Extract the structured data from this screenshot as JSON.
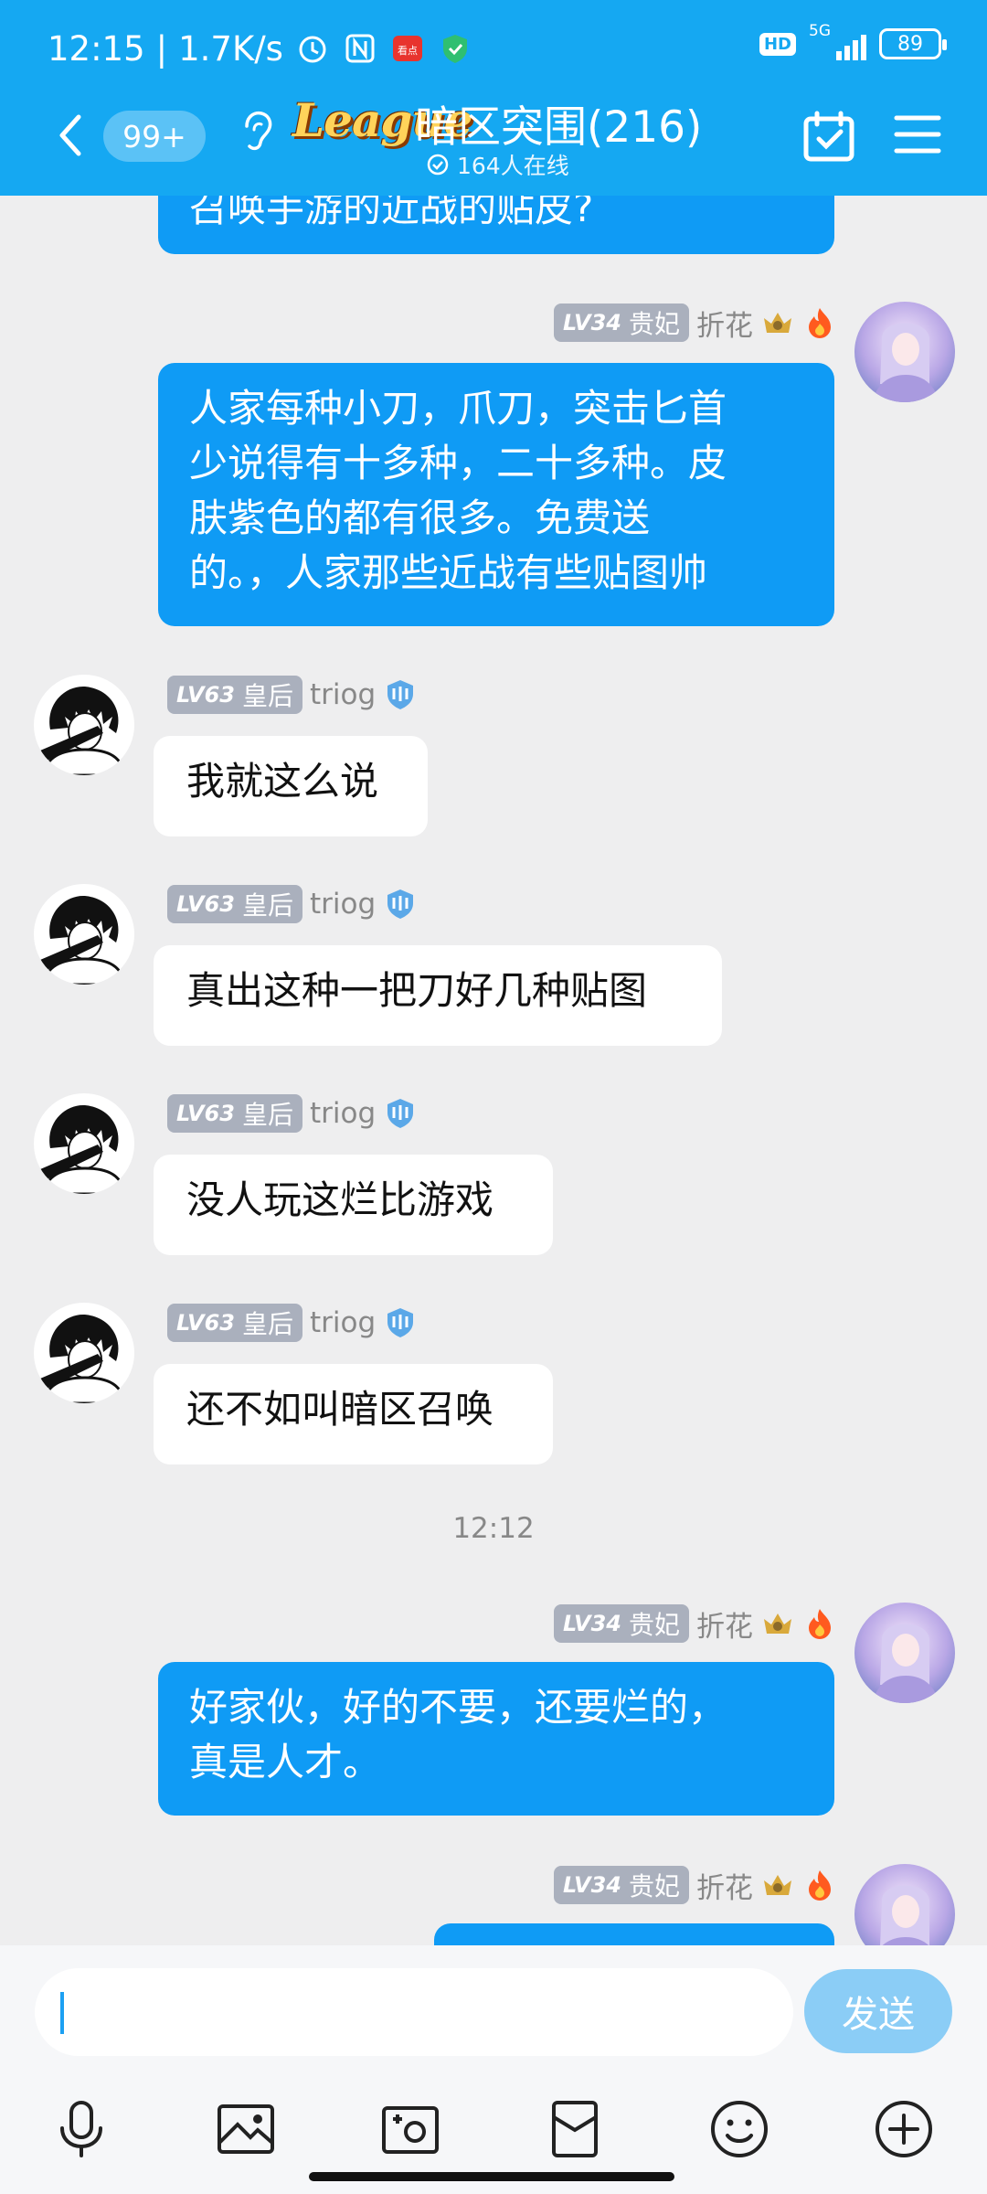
{
  "status": {
    "time": "12:15",
    "speed": "1.7K/s",
    "network": "5G",
    "battery": "89",
    "app_badge": "看点"
  },
  "header": {
    "unread_count": "99+",
    "league_logo_text": "League",
    "group_title": "暗区突围(216)",
    "online_text": "164人在线"
  },
  "messages": [
    {
      "id": 0,
      "direction": "out",
      "text": "召唤手游的近战的贴皮?",
      "partial": true
    },
    {
      "id": 1,
      "direction": "out",
      "level": "LV34",
      "title": "贵妃",
      "name": "折花",
      "lines": [
        "人家每种小刀，爪刀，突击匕首",
        "少说得有十多种，二十多种。皮",
        "肤紫色的都有很多。免费送",
        "的。，人家那些近战有些贴图帅"
      ]
    },
    {
      "id": 2,
      "direction": "in",
      "level": "LV63",
      "title": "皇后",
      "name": "triog",
      "text": "我就这么说"
    },
    {
      "id": 3,
      "direction": "in",
      "level": "LV63",
      "title": "皇后",
      "name": "triog",
      "text": "真出这种一把刀好几种贴图"
    },
    {
      "id": 4,
      "direction": "in",
      "level": "LV63",
      "title": "皇后",
      "name": "triog",
      "text": "没人玩这烂比游戏"
    },
    {
      "id": 5,
      "direction": "in",
      "level": "LV63",
      "title": "皇后",
      "name": "triog",
      "text": "还不如叫暗区召唤"
    },
    {
      "id": 6,
      "direction": "out",
      "level": "LV34",
      "title": "贵妃",
      "name": "折花",
      "lines": [
        "好家伙，好的不要，还要烂的，",
        "真是人才。"
      ]
    },
    {
      "id": 7,
      "direction": "out",
      "level": "LV34",
      "title": "贵妃",
      "name": "折花",
      "text": ""
    }
  ],
  "timestamp": "12:12",
  "composer": {
    "input_value": "",
    "send_label": "发送",
    "tools": [
      "microphone-icon",
      "image-icon",
      "camera-icon",
      "red-packet-icon",
      "emoji-icon",
      "plus-icon"
    ]
  },
  "colors": {
    "header_bg": "#15a8f2",
    "out_bubble": "#0f9bf5",
    "in_bubble": "#ffffff",
    "chat_bg": "#eeeeef",
    "send_button": "#8bcdf6"
  }
}
